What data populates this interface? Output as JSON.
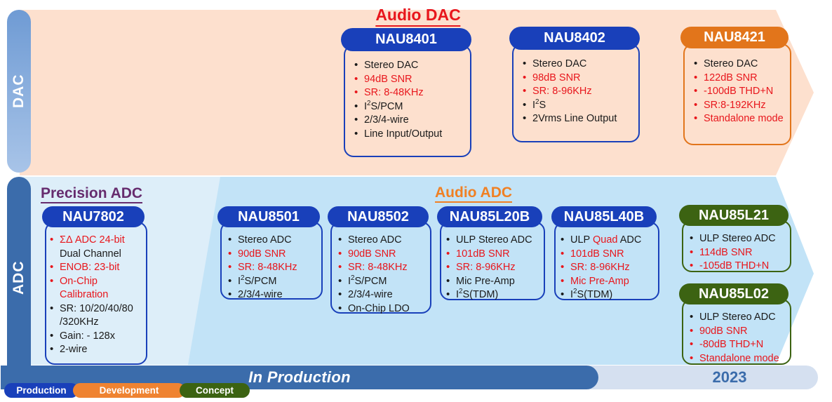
{
  "categories": {
    "dac_label": "DAC",
    "adc_label": "ADC"
  },
  "sections": {
    "audio_dac": {
      "title": "Audio DAC",
      "color": "#e8161c"
    },
    "precision_adc": {
      "title": "Precision ADC",
      "color": "#662c6e"
    },
    "audio_adc": {
      "title": "Audio ADC",
      "color": "#f08023"
    }
  },
  "cards": [
    {
      "name": "NAU8401",
      "theme": "blue",
      "features": [
        {
          "text": "Stereo DAC",
          "red": false
        },
        {
          "text": "94dB SNR",
          "red": true
        },
        {
          "text": "SR: 8-48KHz",
          "red": true
        },
        {
          "text": "I²S/PCM",
          "red": false
        },
        {
          "text": "2/3/4-wire",
          "red": false
        },
        {
          "text": "Line Input/Output",
          "red": false
        }
      ]
    },
    {
      "name": "NAU8402",
      "theme": "blue",
      "features": [
        {
          "text": "Stereo DAC",
          "red": false
        },
        {
          "text": "98dB SNR",
          "red": true
        },
        {
          "text": "SR: 8-96KHz",
          "red": true
        },
        {
          "text": "I²S",
          "red": false
        },
        {
          "text": "2Vrms Line Output",
          "red": false
        }
      ]
    },
    {
      "name": "NAU8421",
      "theme": "orange",
      "features": [
        {
          "text": "Stereo DAC",
          "red": false
        },
        {
          "text": "122dB SNR",
          "red": true
        },
        {
          "text": "-100dB THD+N",
          "red": true
        },
        {
          "text": "SR:8-192KHz",
          "red": true
        },
        {
          "text": "Standalone mode",
          "red": true
        }
      ]
    },
    {
      "name": "NAU7802",
      "theme": "blue",
      "features": [
        {
          "text": "ΣΔ ADC 24-bit",
          "red": true
        },
        {
          "text": "Dual Channel",
          "red": false,
          "no_bullet": true
        },
        {
          "text": "ENOB: 23-bit",
          "red": true
        },
        {
          "text": "On-Chip",
          "red": true
        },
        {
          "text": "Calibration",
          "red": true,
          "no_bullet": true
        },
        {
          "text": "SR: 10/20/40/80",
          "red": false
        },
        {
          "text": "/320KHz",
          "red": false,
          "no_bullet": true
        },
        {
          "text": "Gain: - 128x",
          "red": false
        },
        {
          "text": "2-wire",
          "red": false
        }
      ]
    },
    {
      "name": "NAU8501",
      "theme": "blue",
      "features": [
        {
          "text": "Stereo ADC",
          "red": false
        },
        {
          "text": "90dB SNR",
          "red": true
        },
        {
          "text": "SR: 8-48KHz",
          "red": true
        },
        {
          "text": "I²S/PCM",
          "red": false
        },
        {
          "text": "2/3/4-wire",
          "red": false
        }
      ]
    },
    {
      "name": "NAU8502",
      "theme": "blue",
      "features": [
        {
          "text": "Stereo ADC",
          "red": false
        },
        {
          "text": "90dB SNR",
          "red": true
        },
        {
          "text": "SR: 8-48KHz",
          "red": true
        },
        {
          "text": "I²S/PCM",
          "red": false
        },
        {
          "text": "2/3/4-wire",
          "red": false
        },
        {
          "text": "On-Chip LDO",
          "red": false
        }
      ]
    },
    {
      "name": "NAU85L20B",
      "theme": "blue",
      "features": [
        {
          "text": "ULP Stereo ADC",
          "red": false
        },
        {
          "text": "101dB SNR",
          "red": true
        },
        {
          "text": "SR: 8-96KHz",
          "red": true
        },
        {
          "text": "Mic Pre-Amp",
          "red": false
        },
        {
          "text": "I²S(TDM)",
          "red": false
        }
      ]
    },
    {
      "name": "NAU85L40B",
      "theme": "blue",
      "features": [
        {
          "text": "ULP Quad ADC",
          "red": false,
          "highlight": "Quad"
        },
        {
          "text": "101dB SNR",
          "red": true
        },
        {
          "text": "SR: 8-96KHz",
          "red": true
        },
        {
          "text": "Mic Pre-Amp",
          "red": true
        },
        {
          "text": "I²S(TDM)",
          "red": false
        }
      ]
    },
    {
      "name": "NAU85L21",
      "theme": "green",
      "features": [
        {
          "text": "ULP Stereo ADC",
          "red": false
        },
        {
          "text": "114dB SNR",
          "red": true
        },
        {
          "text": "-105dB THD+N",
          "red": true
        }
      ]
    },
    {
      "name": "NAU85L02",
      "theme": "green",
      "features": [
        {
          "text": "ULP Stereo ADC",
          "red": false
        },
        {
          "text": "90dB SNR",
          "red": true
        },
        {
          "text": "-80dB THD+N",
          "red": true
        },
        {
          "text": "Standalone mode",
          "red": true
        }
      ]
    }
  ],
  "timeline": {
    "fill_label": "In Production",
    "year_label": "2023"
  },
  "legend": [
    {
      "label": "Production",
      "color": "#1940ba"
    },
    {
      "label": "Development",
      "color": "#ef8331"
    },
    {
      "label": "Concept",
      "color": "#3c6312"
    }
  ],
  "palette": {
    "dac_band": "#FDE0CE",
    "adc_band": "#C2E3F7",
    "precision_band": "#DDEEF9",
    "timeline_track": "#d5e0f0",
    "timeline_fill": "#3b6cab"
  }
}
